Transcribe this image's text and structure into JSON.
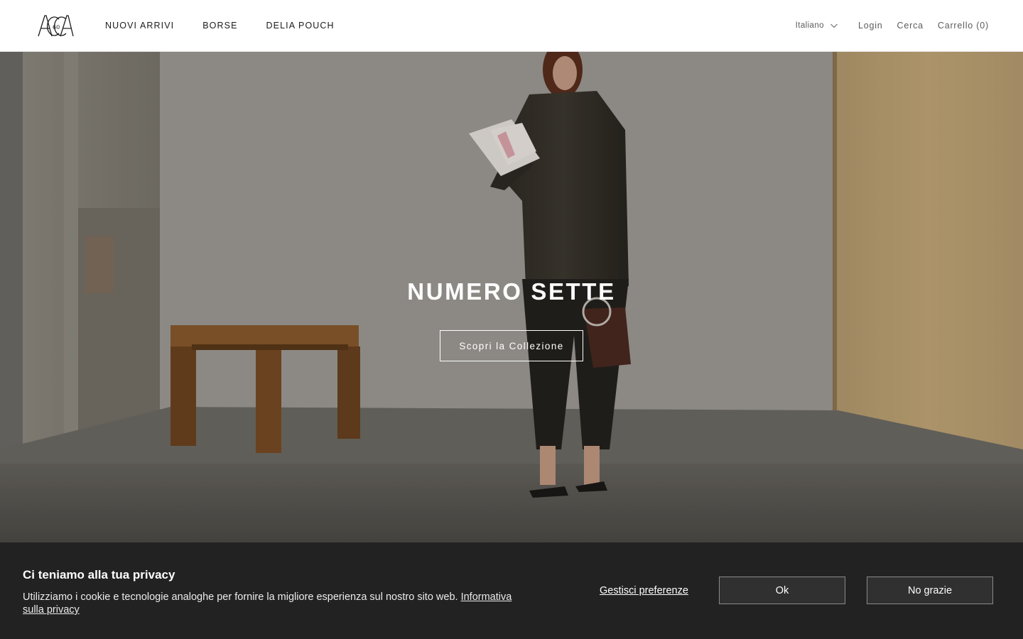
{
  "header": {
    "logo_text": "ACCA",
    "logo_sub": "60",
    "nav": [
      {
        "label": "NUOVI ARRIVI"
      },
      {
        "label": "BORSE"
      },
      {
        "label": "DELIA POUCH"
      }
    ],
    "language": {
      "selected": "Italiano",
      "icon": "chevron-down-icon"
    },
    "login_label": "Login",
    "search_label": "Cerca",
    "cart_label": "Carrello (0)"
  },
  "hero": {
    "title": "NUMERO SETTE",
    "cta_label": "Scopri la Collezione",
    "image_description": "fashion campaign photo"
  },
  "cookie": {
    "title": "Ci teniamo alla tua privacy",
    "text": "Utilizziamo i cookie e tecnologie analoghe per fornire la migliore esperienza sul nostro sito web.",
    "policy_link": "Informativa sulla privacy",
    "manage_label": "Gestisci preferenze",
    "ok_label": "Ok",
    "decline_label": "No grazie"
  },
  "colors": {
    "header_bg": "#ffffff",
    "cookie_bg": "#222222",
    "cookie_button_bg": "#303030",
    "hero_text": "#ffffff"
  }
}
